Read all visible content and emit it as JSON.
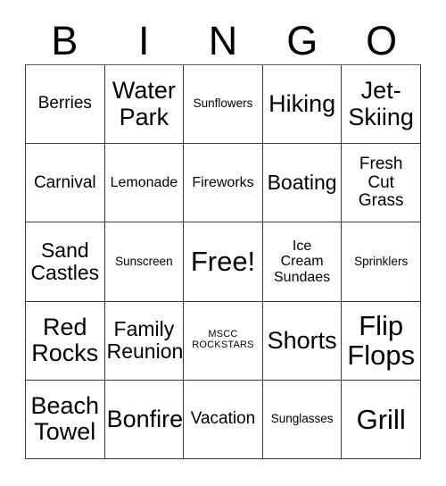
{
  "header": {
    "letters": [
      "B",
      "I",
      "N",
      "G",
      "O"
    ]
  },
  "grid": {
    "rows": [
      [
        {
          "label": "Berries",
          "size": "lg"
        },
        {
          "label": "Water\nPark",
          "size": "xxl"
        },
        {
          "label": "Sunflowers",
          "size": "sm"
        },
        {
          "label": "Hiking",
          "size": "xxl"
        },
        {
          "label": "Jet-\nSkiing",
          "size": "xxl"
        }
      ],
      [
        {
          "label": "Carnival",
          "size": "lg"
        },
        {
          "label": "Lemonade",
          "size": "md"
        },
        {
          "label": "Fireworks",
          "size": "md"
        },
        {
          "label": "Boating",
          "size": "xl"
        },
        {
          "label": "Fresh\nCut\nGrass",
          "size": "lg"
        }
      ],
      [
        {
          "label": "Sand\nCastles",
          "size": "xl"
        },
        {
          "label": "Sunscreen",
          "size": "sm"
        },
        {
          "label": "Free!",
          "size": "huge"
        },
        {
          "label": "Ice\nCream\nSundaes",
          "size": "md"
        },
        {
          "label": "Sprinklers",
          "size": "sm"
        }
      ],
      [
        {
          "label": "Red\nRocks",
          "size": "xxl"
        },
        {
          "label": "Family\nReunion",
          "size": "xl"
        },
        {
          "label": "MSCC\nROCKSTARS",
          "size": "xs"
        },
        {
          "label": "Shorts",
          "size": "xxl"
        },
        {
          "label": "Flip\nFlops",
          "size": "huge"
        }
      ],
      [
        {
          "label": "Beach\nTowel",
          "size": "xxl"
        },
        {
          "label": "Bonfire",
          "size": "xxl"
        },
        {
          "label": "Vacation",
          "size": "lg"
        },
        {
          "label": "Sunglasses",
          "size": "sm"
        },
        {
          "label": "Grill",
          "size": "huge"
        }
      ]
    ]
  }
}
